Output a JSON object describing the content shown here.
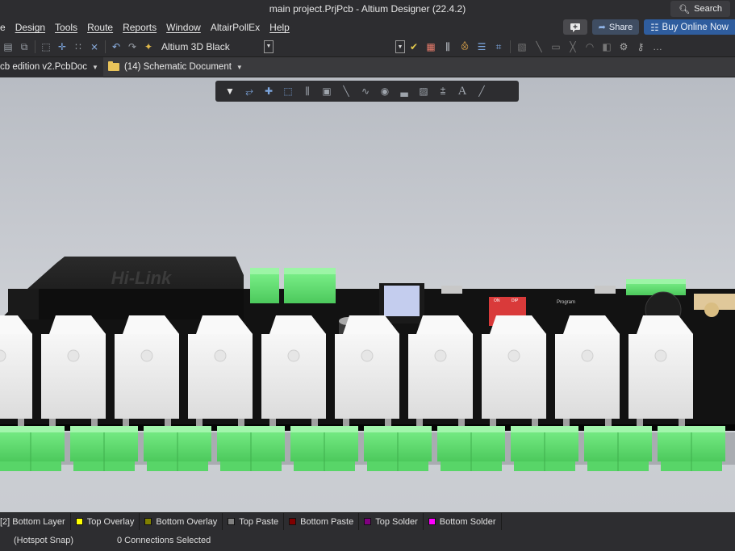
{
  "window": {
    "title": "main project.PrjPcb - Altium Designer (22.4.2)",
    "search_label": "Search"
  },
  "menubar": {
    "items": [
      "e",
      "Design",
      "Tools",
      "Route",
      "Reports",
      "Window",
      "AltairPollEx",
      "Help"
    ],
    "share_label": "Share",
    "buy_label": "Buy Online Now"
  },
  "toolbar": {
    "view_config": "Altium 3D Black"
  },
  "doc_tabs": [
    {
      "label": "cb edition v2.PcbDoc",
      "icon": "pcb-doc-icon"
    },
    {
      "label": "(14) Schematic Document",
      "icon": "folder-icon"
    }
  ],
  "board": {
    "hilink_text": "Hi-Link",
    "dip_on": "ON",
    "dip_dip": "DIP",
    "program_label": "Program",
    "relay_count": 10,
    "terminal_count": 10
  },
  "layer_tabs": [
    {
      "label": "[2] Bottom Layer",
      "color": "#2a5bd7"
    },
    {
      "label": "Top Overlay",
      "color": "#ffff00"
    },
    {
      "label": "Bottom Overlay",
      "color": "#808000"
    },
    {
      "label": "Top Paste",
      "color": "#808080"
    },
    {
      "label": "Bottom Paste",
      "color": "#800000"
    },
    {
      "label": "Top Solder",
      "color": "#800080"
    },
    {
      "label": "Bottom Solder",
      "color": "#ff00ff"
    }
  ],
  "status": {
    "snap": "(Hotspot Snap)",
    "connections": "0 Connections Selected"
  },
  "colors": {
    "chrome_bg": "#2d2d30",
    "accent_blue": "#2f5d9e",
    "terminal_green": "#6ee57a",
    "pcb_black": "#141414",
    "relay_white": "#f2f2f2"
  }
}
